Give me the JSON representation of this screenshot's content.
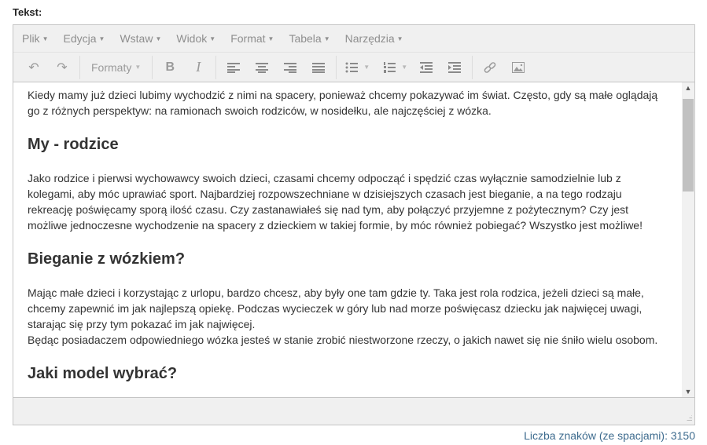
{
  "label": "Tekst:",
  "menubar": [
    "Plik",
    "Edycja",
    "Wstaw",
    "Widok",
    "Format",
    "Tabela",
    "Narzędzia"
  ],
  "toolbar": {
    "formats": "Formaty",
    "icons": [
      "undo-icon",
      "redo-icon",
      "bold-icon",
      "italic-icon",
      "align-left-icon",
      "align-center-icon",
      "align-right-icon",
      "align-justify-icon",
      "bullet-list-icon",
      "numbered-list-icon",
      "outdent-icon",
      "indent-icon",
      "link-icon",
      "image-icon"
    ]
  },
  "content": {
    "p1": "Kiedy mamy już dzieci lubimy wychodzić z nimi na spacery, ponieważ chcemy pokazywać im świat. Często, gdy są małe oglądają go z różnych perspektyw: na ramionach swoich rodziców, w nosidełku, ale najczęściej z wózka.",
    "h1": "My - rodzice",
    "p2": "Jako rodzice i pierwsi wychowawcy swoich dzieci, czasami chcemy odpocząć i spędzić czas wyłącznie samodzielnie lub z kolegami, aby móc uprawiać sport. Najbardziej rozpowszechniane w dzisiejszych czasach jest bieganie, a na tego rodzaju rekreację poświęcamy sporą ilość czasu. Czy zastanawiałeś się nad tym, aby połączyć przyjemne z pożytecznym? Czy jest możliwe jednoczesne wychodzenie na spacery z dzieckiem w takiej formie, by móc również pobiegać? Wszystko jest możliwe!",
    "h2": "Bieganie z wózkiem?",
    "p3a": "Mając małe dzieci i korzystając z urlopu, bardzo chcesz, aby były one tam gdzie ty. Taka jest rola rodzica, jeżeli dzieci są małe, chcemy zapewnić im jak najlepszą opiekę. Podczas wycieczek w góry lub nad morze poświęcasz dziecku jak najwięcej uwagi, starając się przy tym pokazać im jak najwięcej.",
    "p3b": "Będąc posiadaczem odpowiedniego wózka jesteś w stanie zrobić niestworzone rzeczy, o jakich nawet się nie śniło wielu osobom.",
    "h3": "Jaki model wybrać?"
  },
  "char_count": "Liczba znaków (ze spacjami): 3150"
}
